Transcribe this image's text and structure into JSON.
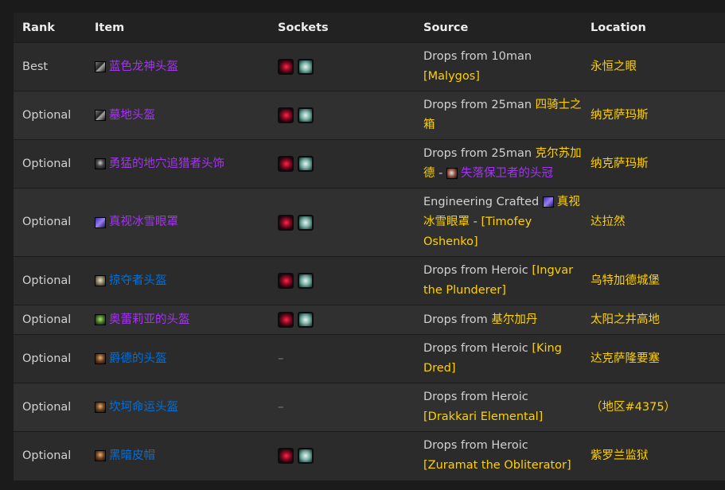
{
  "headers": {
    "rank": "Rank",
    "item": "Item",
    "sockets": "Sockets",
    "source": "Source",
    "location": "Location"
  },
  "colors": {
    "epic": "#a335ee",
    "rare": "#0070dd",
    "gold": "#ffd100",
    "meta_socket": "#d4102f",
    "prismatic_socket": "#8fc3b6"
  },
  "rows": [
    {
      "rank": "Best",
      "item": "蓝色龙神头盔",
      "item_icon": "helm-icon",
      "sockets": [
        "meta-socket-icon",
        "prismatic-socket-icon"
      ],
      "socket_empty": "",
      "source": {
        "prefix": "Drops from 10man ",
        "link": "[Malygos]",
        "sep": "",
        "icon2": "",
        "link2": ""
      },
      "location": "永恒之眼"
    },
    {
      "rank": "Optional",
      "item": "墓地头盔",
      "item_icon": "helm-icon",
      "sockets": [
        "meta-socket-icon",
        "prismatic-socket-icon"
      ],
      "socket_empty": "",
      "source": {
        "prefix": "Drops from 25man ",
        "link": "四骑士之箱",
        "sep": "",
        "icon2": "",
        "link2": ""
      },
      "location": "纳克萨玛斯"
    },
    {
      "rank": "Optional",
      "item": "勇猛的地穴追猎者头饰",
      "item_icon": "hood-icon",
      "sockets": [
        "meta-socket-icon",
        "prismatic-socket-icon"
      ],
      "socket_empty": "",
      "source": {
        "prefix": "Drops from 25man ",
        "link": "克尔苏加德",
        "sep": " - ",
        "icon2": "token-icon",
        "link2": "失落保卫者的头冠"
      },
      "location": "纳克萨玛斯"
    },
    {
      "rank": "Optional",
      "item": "真视冰雪眼罩",
      "item_icon": "goggles-icon",
      "sockets": [
        "meta-socket-icon",
        "prismatic-socket-icon"
      ],
      "socket_empty": "",
      "source": {
        "prefix": "Engineering Crafted ",
        "link": "",
        "sep": "",
        "icon2": "goggles-icon",
        "link2": "真视冰雪眼罩",
        "suffix_sep": " - ",
        "link3": "[Timofey Oshenko]"
      },
      "location": "达拉然"
    },
    {
      "rank": "Optional",
      "item": "掠夺者头盔",
      "item_icon": "skull-helm-icon",
      "sockets": [
        "meta-socket-icon",
        "prismatic-socket-icon"
      ],
      "socket_empty": "",
      "source": {
        "prefix": "Drops from Heroic ",
        "link": "[Ingvar the Plunderer]",
        "sep": "",
        "icon2": "",
        "link2": ""
      },
      "location": "乌特加德城堡"
    },
    {
      "rank": "Optional",
      "item": "奥蕾莉亚的头盔",
      "item_icon": "green-helm-icon",
      "sockets": [
        "meta-socket-icon",
        "prismatic-socket-icon"
      ],
      "socket_empty": "",
      "source": {
        "prefix": "Drops from ",
        "link": "基尔加丹",
        "sep": "",
        "icon2": "",
        "link2": ""
      },
      "location": "太阳之井高地"
    },
    {
      "rank": "Optional",
      "item": "爵德的头盔",
      "item_icon": "leather-helm-icon",
      "sockets": [],
      "socket_empty": "–",
      "source": {
        "prefix": "Drops from Heroic ",
        "link": "[King Dred]",
        "sep": "",
        "icon2": "",
        "link2": ""
      },
      "location": "达克萨隆要塞"
    },
    {
      "rank": "Optional",
      "item": "坎坷命运头盔",
      "item_icon": "leather-helm-icon",
      "sockets": [],
      "socket_empty": "–",
      "source": {
        "prefix": "Drops from Heroic ",
        "link": "[Drakkari Elemental]",
        "sep": "",
        "icon2": "",
        "link2": ""
      },
      "location": "（地区#4375）"
    },
    {
      "rank": "Optional",
      "item": "黑暗皮帽",
      "item_icon": "leather-helm-icon",
      "sockets": [
        "meta-socket-icon",
        "prismatic-socket-icon"
      ],
      "socket_empty": "",
      "source": {
        "prefix": "Drops from Heroic ",
        "link": "[Zuramat the Obliterator]",
        "sep": "",
        "icon2": "",
        "link2": ""
      },
      "location": "紫罗兰监狱"
    }
  ]
}
